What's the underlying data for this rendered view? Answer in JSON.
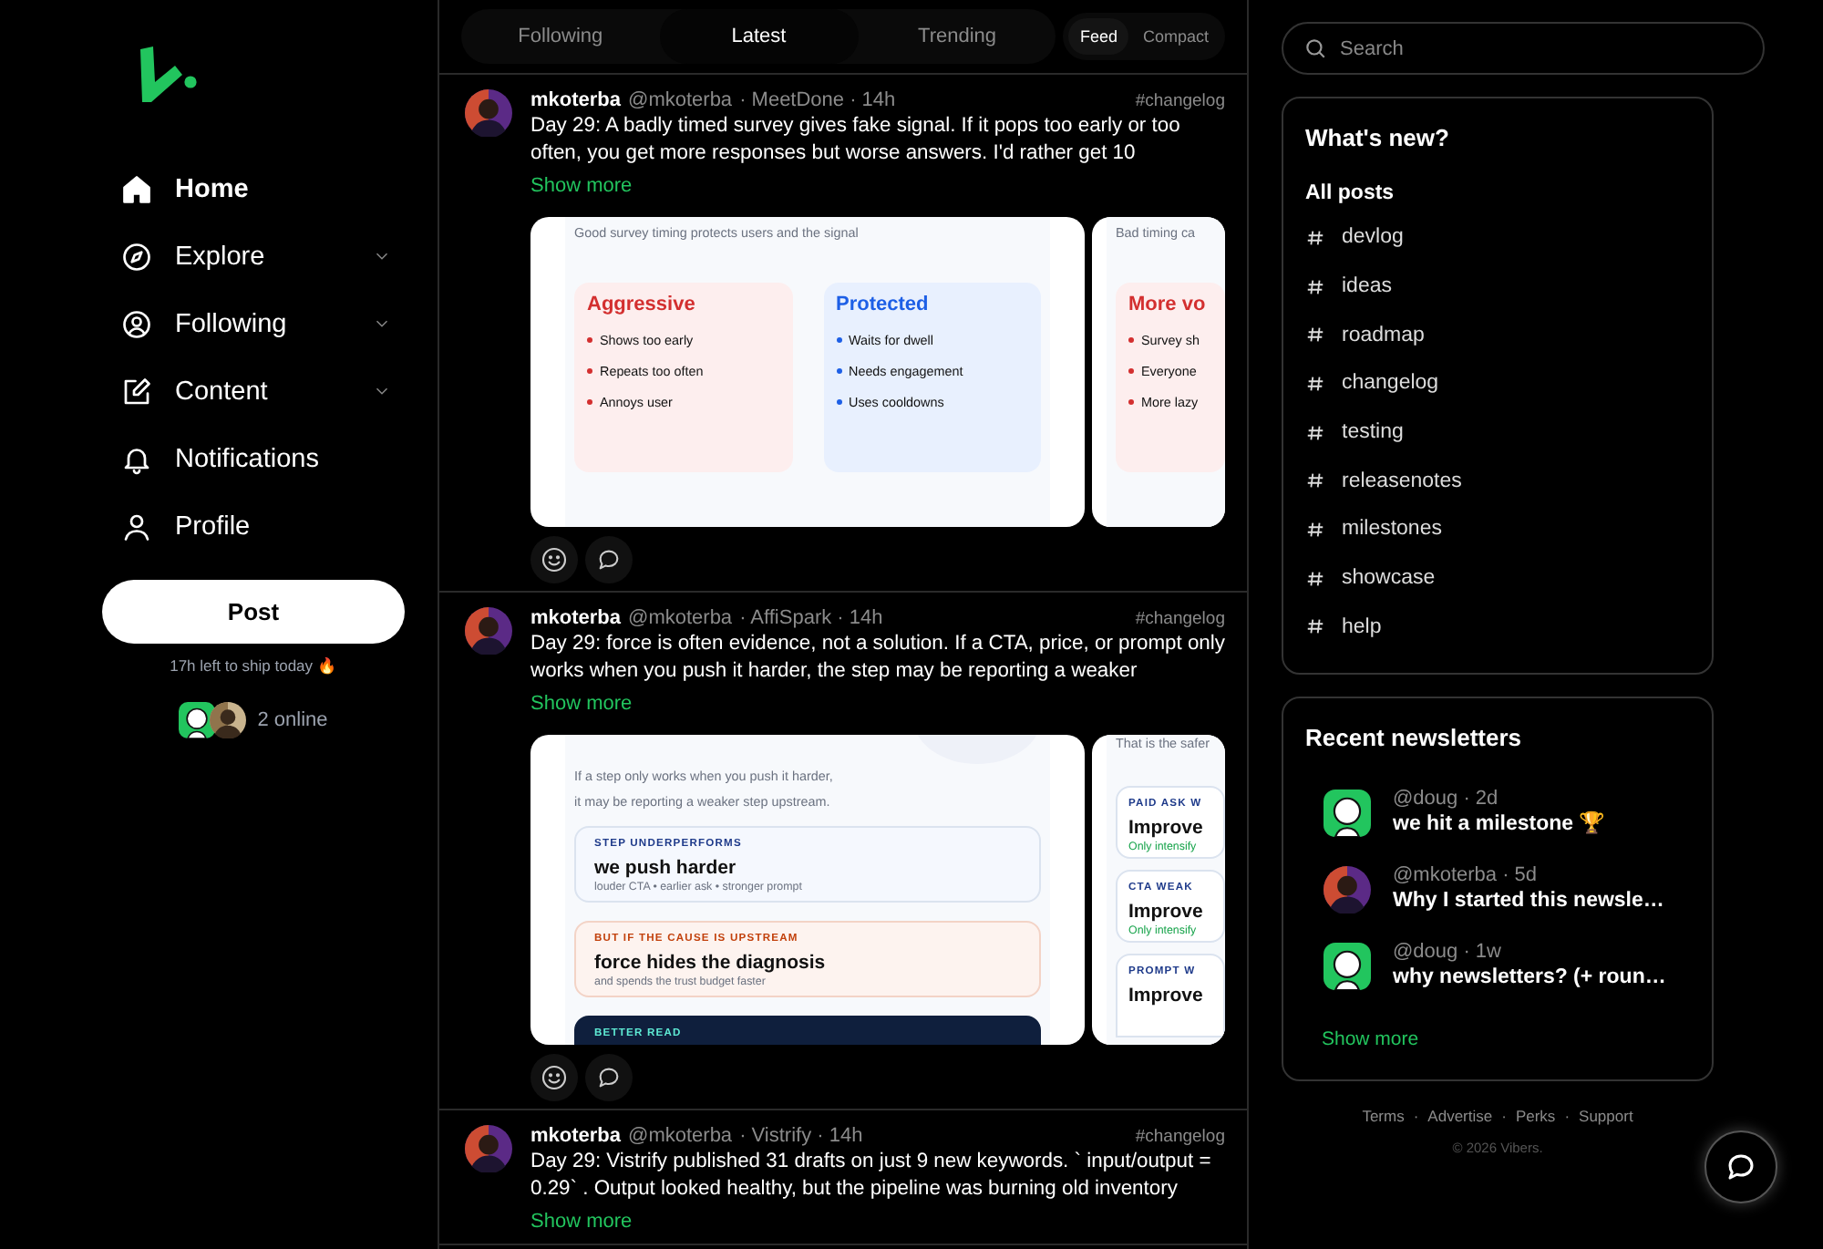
{
  "sidebar": {
    "nav": [
      {
        "label": "Home",
        "selected": true,
        "expandable": false
      },
      {
        "label": "Explore",
        "selected": false,
        "expandable": true
      },
      {
        "label": "Following",
        "selected": false,
        "expandable": true
      },
      {
        "label": "Content",
        "selected": false,
        "expandable": true
      },
      {
        "label": "Notifications",
        "selected": false,
        "expandable": false
      },
      {
        "label": "Profile",
        "selected": false,
        "expandable": false
      }
    ],
    "post_button": "Post",
    "ship_note": "17h left to ship today 🔥",
    "online": {
      "avatars": [
        {
          "kind": "mascot"
        },
        {
          "kind": "portrait-warm"
        }
      ],
      "label": "2 online"
    }
  },
  "feed": {
    "tabs": [
      {
        "label": "Following",
        "selected": false
      },
      {
        "label": "Latest",
        "selected": true
      },
      {
        "label": "Trending",
        "selected": false
      }
    ],
    "views": [
      {
        "label": "Feed",
        "selected": true
      },
      {
        "label": "Compact",
        "selected": false
      }
    ],
    "posts": [
      {
        "avatar": {
          "kind": "portrait"
        },
        "author": "mkoterba",
        "handle": "@mkoterba",
        "meta": "· MeetDone · 14h",
        "tag": "#changelog",
        "text": "Day 29: A badly timed survey gives fake signal. If it pops too early or too often, you get more responses but worse answers. I'd rather get 10",
        "show_more": "Show more",
        "actions": [
          {
            "kind": "react"
          },
          {
            "kind": "comment"
          }
        ],
        "slides": [
          {
            "kind": "compare",
            "caption": [
              "Good survey timing protects users and the signal"
            ],
            "columns": [
              {
                "title": "Aggressive",
                "kind": "red",
                "items": [
                  "Shows too early",
                  "Repeats too often",
                  "Annoys user"
                ]
              },
              {
                "title": "Protected",
                "kind": "blue",
                "items": [
                  "Waits for dwell",
                  "Needs engagement",
                  "Uses cooldowns"
                ]
              }
            ]
          },
          {
            "kind": "compare",
            "caption": [
              "Bad timing ca"
            ],
            "columns": [
              {
                "title": "More vo",
                "kind": "red",
                "items": [
                  "Survey sh",
                  "Everyone",
                  "More lazy"
                ]
              }
            ]
          }
        ]
      },
      {
        "avatar": {
          "kind": "portrait"
        },
        "author": "mkoterba",
        "handle": "@mkoterba",
        "meta": "· AffiSpark · 14h",
        "tag": "#changelog",
        "text": "Day 29: force is often evidence, not a solution. If a CTA, price, or prompt only works when you push it harder, the step may be reporting a weaker",
        "show_more": "Show more",
        "actions": [
          {
            "kind": "react"
          },
          {
            "kind": "comment"
          }
        ],
        "slides": [
          {
            "kind": "stack",
            "caption": [
              "If a step only works when you push it harder,",
              "it may be reporting a weaker step upstream."
            ],
            "cards": [
              {
                "kind": "blue",
                "label": "STEP UNDERPERFORMS",
                "title": "we push harder",
                "note": "louder CTA • earlier ask • stronger prompt"
              },
              {
                "kind": "red",
                "label": "BUT IF THE CAUSE IS UPSTREAM",
                "title": "force hides the diagnosis",
                "note": "and spends the trust budget faster"
              },
              {
                "kind": "dark",
                "label": "BETTER READ"
              }
            ]
          },
          {
            "kind": "stack",
            "caption": [
              "That is the safer"
            ],
            "cards": [
              {
                "kind": "plain",
                "label": "PAID ASK W",
                "title": "Improve",
                "note": "Only intensify"
              },
              {
                "kind": "plain",
                "label": "CTA WEAK",
                "title": "Improve",
                "note": "Only intensify"
              },
              {
                "kind": "plain",
                "label": "PROMPT W",
                "title": "Improve"
              }
            ]
          }
        ]
      },
      {
        "avatar": {
          "kind": "portrait"
        },
        "author": "mkoterba",
        "handle": "@mkoterba",
        "meta": "· Vistrify · 14h",
        "tag": "#changelog",
        "text": "Day 29: Vistrify published 31 drafts on just 9 new keywords. ` input/output = 0.29` . Output looked healthy, but the pipeline was burning old inventory",
        "show_more": "Show more"
      }
    ]
  },
  "rail": {
    "search": {
      "placeholder": "Search"
    },
    "whats_new": {
      "title": "What's new?",
      "topics": [
        {
          "label": "All posts",
          "kind": "all",
          "selected": true
        },
        {
          "label": "devlog",
          "kind": "tag",
          "selected": false
        },
        {
          "label": "ideas",
          "kind": "tag",
          "selected": false
        },
        {
          "label": "roadmap",
          "kind": "tag",
          "selected": false
        },
        {
          "label": "changelog",
          "kind": "tag",
          "selected": false
        },
        {
          "label": "testing",
          "kind": "tag",
          "selected": false
        },
        {
          "label": "releasenotes",
          "kind": "tag",
          "selected": false
        },
        {
          "label": "milestones",
          "kind": "tag",
          "selected": false
        },
        {
          "label": "showcase",
          "kind": "tag",
          "selected": false
        },
        {
          "label": "help",
          "kind": "tag",
          "selected": false
        }
      ]
    },
    "newsletters": {
      "title": "Recent newsletters",
      "items": [
        {
          "avatar": {
            "kind": "mascot"
          },
          "byline": "@doug · 2d",
          "title": "we hit a milestone 🏆"
        },
        {
          "avatar": {
            "kind": "portrait"
          },
          "byline": "@mkoterba · 5d",
          "title": "Why I started this newsle…"
        },
        {
          "avatar": {
            "kind": "mascot"
          },
          "byline": "@doug · 1w",
          "title": "why newsletters? (+ roun…"
        }
      ],
      "show_more": "Show more"
    },
    "footer": {
      "links": [
        "Terms",
        "Advertise",
        "Perks",
        "Support"
      ],
      "separator": "·",
      "copyright": "© 2026 Vibers."
    }
  }
}
